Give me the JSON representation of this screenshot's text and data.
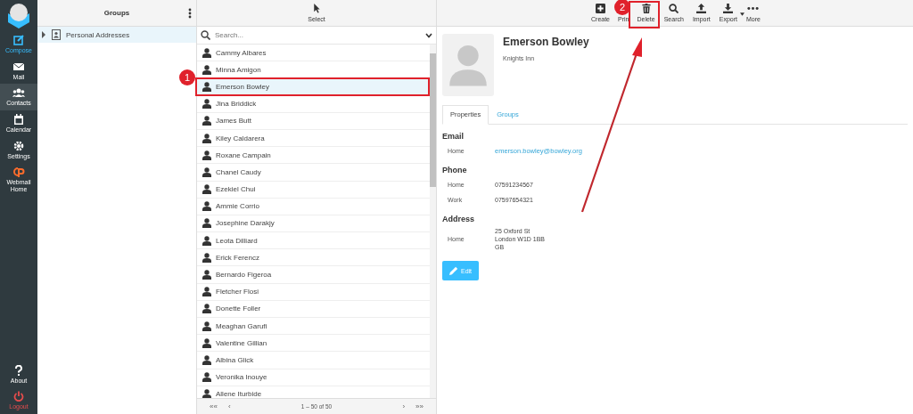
{
  "nav": [
    {
      "label": "Compose",
      "kind": "compose",
      "selected": false
    },
    {
      "label": "Mail",
      "kind": "mail",
      "selected": false
    },
    {
      "label": "Contacts",
      "kind": "contacts",
      "selected": true
    },
    {
      "label": "Calendar",
      "kind": "calendar",
      "selected": false
    },
    {
      "label": "Settings",
      "kind": "settings",
      "selected": false
    },
    {
      "label": "Webmail Home",
      "kind": "cpanel",
      "selected": false
    }
  ],
  "nav_bottom": [
    {
      "label": "About",
      "kind": "about"
    },
    {
      "label": "Logout",
      "kind": "logout"
    }
  ],
  "groups": {
    "title": "Groups",
    "items": [
      {
        "label": "Personal Addresses",
        "selected": true,
        "expanded": false
      }
    ]
  },
  "list": {
    "toolbar": "Select",
    "search": {
      "placeholder": "Search..."
    },
    "contacts": [
      {
        "name": "Cammy Albares",
        "selected": false
      },
      {
        "name": "Minna Amigon",
        "selected": false
      },
      {
        "name": "Emerson Bowley",
        "selected": true
      },
      {
        "name": "Jina Briddick",
        "selected": false
      },
      {
        "name": "James Butt",
        "selected": false
      },
      {
        "name": "Kiley Caldarera",
        "selected": false
      },
      {
        "name": "Roxane Campain",
        "selected": false
      },
      {
        "name": "Chanel Caudy",
        "selected": false
      },
      {
        "name": "Ezekiel Chui",
        "selected": false
      },
      {
        "name": "Ammie Corrio",
        "selected": false
      },
      {
        "name": "Josephine Darakjy",
        "selected": false
      },
      {
        "name": "Leota Dilliard",
        "selected": false
      },
      {
        "name": "Erick Ferencz",
        "selected": false
      },
      {
        "name": "Bernardo Figeroa",
        "selected": false
      },
      {
        "name": "Fletcher Flosi",
        "selected": false
      },
      {
        "name": "Donette Foller",
        "selected": false
      },
      {
        "name": "Meaghan Garufi",
        "selected": false
      },
      {
        "name": "Valentine Gillian",
        "selected": false
      },
      {
        "name": "Albina Glick",
        "selected": false
      },
      {
        "name": "Veronika Inouye",
        "selected": false
      },
      {
        "name": "Allene Iturbide",
        "selected": false
      }
    ],
    "pager": {
      "first": "««",
      "prev": "‹",
      "count": "1 – 50 of 50",
      "next": "›",
      "last": "»»"
    }
  },
  "toolbar": [
    {
      "label": "Create",
      "kind": "create"
    },
    {
      "label": "Prin",
      "kind": "print"
    },
    {
      "label": "Delete",
      "kind": "delete"
    },
    {
      "label": "Search",
      "kind": "search"
    },
    {
      "label": "Import",
      "kind": "import"
    },
    {
      "label": "Export",
      "kind": "export"
    },
    {
      "label": "More",
      "kind": "more"
    }
  ],
  "contact": {
    "name": "Emerson Bowley",
    "organization": "Knights Inn",
    "tabs": [
      {
        "label": "Properties",
        "selected": true
      },
      {
        "label": "Groups",
        "selected": false
      }
    ],
    "sections": [
      {
        "title": "Email",
        "fields": [
          {
            "label": "Home",
            "lines": [
              "emerson.bowley@bowley.org"
            ],
            "kind": "link"
          }
        ]
      },
      {
        "title": "Phone",
        "fields": [
          {
            "label": "Home",
            "lines": [
              "07591234567"
            ],
            "kind": "text"
          },
          {
            "label": "Work",
            "lines": [
              "07597654321"
            ],
            "kind": "text"
          }
        ]
      },
      {
        "title": "Address",
        "fields": [
          {
            "label": "Home",
            "lines": [
              "25 Oxford St",
              "London W1D 1BB",
              "GB"
            ],
            "kind": "text"
          }
        ]
      }
    ],
    "edit_button": "Edit"
  },
  "annotations": [
    {
      "label": "1",
      "kind": "row"
    },
    {
      "label": "2",
      "kind": "delete"
    }
  ]
}
